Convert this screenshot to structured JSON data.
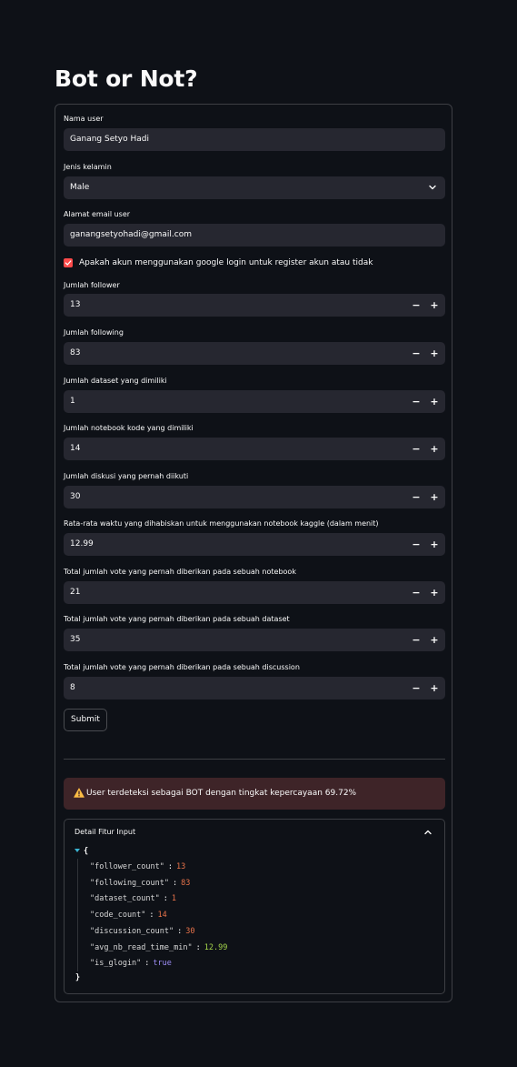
{
  "page": {
    "title": "Bot or Not?"
  },
  "form": {
    "name_field": {
      "label": "Nama user",
      "value": "Ganang Setyo Hadi"
    },
    "gender_select": {
      "label": "Jenis kelamin",
      "value": "Male"
    },
    "email_field": {
      "label": "Alamat email user",
      "value": "ganangsetyohadi@gmail.com"
    },
    "google_login_checkbox": {
      "label": "Apakah akun menggunakan google login untuk register akun atau tidak",
      "checked": true
    },
    "number_inputs": [
      {
        "label": "Jumlah follower",
        "value": "13"
      },
      {
        "label": "Jumlah following",
        "value": "83"
      },
      {
        "label": "Jumlah dataset yang dimiliki",
        "value": "1"
      },
      {
        "label": "Jumlah notebook kode yang dimiliki",
        "value": "14"
      },
      {
        "label": "Jumlah diskusi yang pernah diikuti",
        "value": "30"
      },
      {
        "label": "Rata-rata waktu yang dihabiskan untuk menggunakan notebook kaggle (dalam menit)",
        "value": "12.99"
      },
      {
        "label": "Total jumlah vote yang pernah diberikan pada sebuah notebook",
        "value": "21"
      },
      {
        "label": "Total jumlah vote yang pernah diberikan pada sebuah dataset",
        "value": "35"
      },
      {
        "label": "Total jumlah vote yang pernah diberikan pada sebuah discussion",
        "value": "8"
      }
    ],
    "stepper": {
      "minus": "−",
      "plus": "+"
    },
    "submit_label": "Submit"
  },
  "result": {
    "warning_icon": "warning-icon",
    "warning_text": "User terdeteksi sebagai BOT dengan tingkat kepercayaan 69.72%"
  },
  "expander": {
    "title": "Detail Fitur Input",
    "expanded": true,
    "json": {
      "open_brace": "{",
      "close_brace": "}",
      "entries": [
        {
          "key": "\"follower_count\"",
          "value": "13",
          "type": "int"
        },
        {
          "key": "\"following_count\"",
          "value": "83",
          "type": "int"
        },
        {
          "key": "\"dataset_count\"",
          "value": "1",
          "type": "int"
        },
        {
          "key": "\"code_count\"",
          "value": "14",
          "type": "int"
        },
        {
          "key": "\"discussion_count\"",
          "value": "30",
          "type": "int"
        },
        {
          "key": "\"avg_nb_read_time_min\"",
          "value": "12.99",
          "type": "float"
        },
        {
          "key": "\"is_glogin\"",
          "value": "true",
          "type": "bool"
        }
      ]
    }
  },
  "colors": {
    "background": "#0e1117",
    "input_bg": "#262730",
    "accent_red": "#ff4b4b",
    "warning_bg": "#3e2428",
    "warning_icon": "#ffbd45",
    "json_int": "#e8734a",
    "json_float": "#a3d44a",
    "json_bool": "#9c8cf5"
  }
}
